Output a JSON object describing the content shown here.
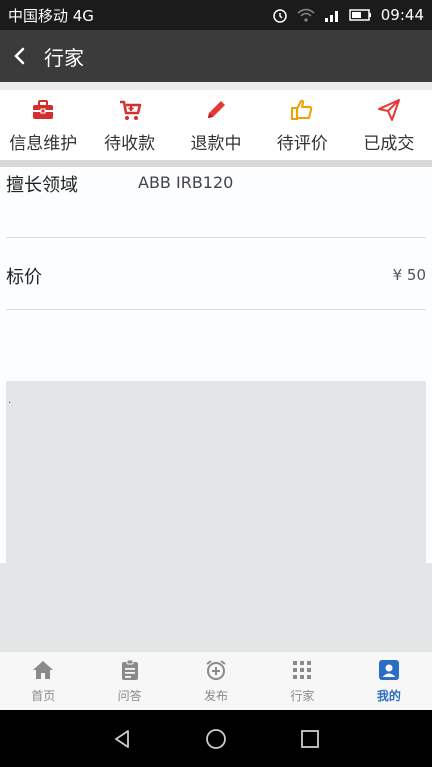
{
  "status_bar": {
    "carrier": "中国移动 4G",
    "time": "09:44"
  },
  "header": {
    "title": "行家"
  },
  "actions": [
    {
      "label": "信息维护",
      "icon": "briefcase-icon",
      "color": "#d32f2f"
    },
    {
      "label": "待收款",
      "icon": "cart-icon",
      "color": "#d32f2f"
    },
    {
      "label": "退款中",
      "icon": "pencil-icon",
      "color": "#e53935"
    },
    {
      "label": "待评价",
      "icon": "thumbs-up-icon",
      "color": "#f0a000"
    },
    {
      "label": "已成交",
      "icon": "paper-plane-icon",
      "color": "#e53935"
    }
  ],
  "detail": {
    "field_label": "擅长领域",
    "field_value": "ABB IRB120",
    "price_label": "标价",
    "price_value": "¥ 50",
    "dot": "."
  },
  "tabs": [
    {
      "label": "首页",
      "icon": "home-icon"
    },
    {
      "label": "问答",
      "icon": "clipboard-icon"
    },
    {
      "label": "发布",
      "icon": "alarm-add-icon"
    },
    {
      "label": "行家",
      "icon": "grid-icon"
    },
    {
      "label": "我的",
      "icon": "profile-icon",
      "active": true
    }
  ],
  "accent_color": "#2b6cc4"
}
